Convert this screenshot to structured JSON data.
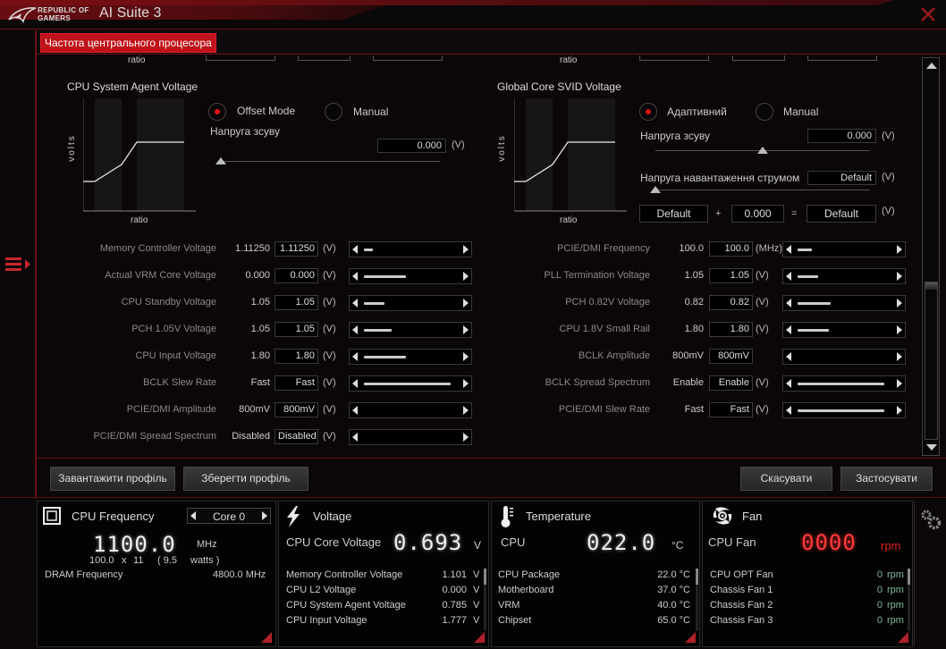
{
  "window": {
    "brand_line1": "REPUBLIC OF",
    "brand_line2": "GAMERS",
    "title": "AI Suite 3"
  },
  "tab": {
    "active_label": "Частота центрального процесора"
  },
  "top_partial": {
    "ratio_left": "ratio",
    "ratio_right": "ratio"
  },
  "sa_voltage": {
    "title": "CPU System Agent Voltage",
    "graph_y": "volts",
    "graph_x": "ratio",
    "mode_options": [
      {
        "label": "Offset Mode",
        "selected": true
      },
      {
        "label": "Manual",
        "selected": false
      }
    ],
    "offset_label": "Напруга зсуву",
    "offset_value": "0.000",
    "unit": "(V)",
    "slider_fraction": 0.0
  },
  "svid_voltage": {
    "title": "Global Core SVID Voltage",
    "graph_y": "volts",
    "graph_x": "ratio",
    "mode_options": [
      {
        "label": "Адаптивний",
        "selected": true
      },
      {
        "label": "Manual",
        "selected": false
      }
    ],
    "offset_label": "Напруга зсуву",
    "offset_value": "0.000",
    "offset_slider_fraction": 0.5,
    "load_label": "Напруга навантаження струмом",
    "load_value": "Default",
    "load_slider_fraction": 0.0,
    "unit": "(V)",
    "sum": {
      "a": "Default",
      "plus": "+",
      "b": "0.000",
      "eq": "=",
      "result": "Default",
      "unit": "(V)"
    }
  },
  "left_rows": [
    {
      "label": "Memory Controller Voltage",
      "current": "1.11250",
      "value": "1.11250",
      "unit": "(V)",
      "fill": 0.1
    },
    {
      "label": "Actual VRM Core Voltage",
      "current": "0.000",
      "value": "0.000",
      "unit": "(V)",
      "fill": 0.45
    },
    {
      "label": "CPU Standby Voltage",
      "current": "1.05",
      "value": "1.05",
      "unit": "(V)",
      "fill": 0.22
    },
    {
      "label": "PCH 1.05V Voltage",
      "current": "1.05",
      "value": "1.05",
      "unit": "(V)",
      "fill": 0.3
    },
    {
      "label": "CPU Input Voltage",
      "current": "1.80",
      "value": "1.80",
      "unit": "(V)",
      "fill": 0.45
    },
    {
      "label": "BCLK Slew Rate",
      "current": "Fast",
      "value": "Fast",
      "unit": "(V)",
      "fill": 0.93
    },
    {
      "label": "PCIE/DMI Amplitude",
      "current": "800mV",
      "value": "800mV",
      "unit": "(V)",
      "fill": 0
    },
    {
      "label": "PCIE/DMI Spread Spectrum",
      "current": "Disabled",
      "value": "Disabled",
      "unit": "(V)",
      "fill": 0
    }
  ],
  "right_rows": [
    {
      "label": "PCIE/DMI Frequency",
      "current": "100.0",
      "value": "100.0",
      "unit": "(MHz)",
      "fill": 0.15
    },
    {
      "label": "PLL Termination Voltage",
      "current": "1.05",
      "value": "1.05",
      "unit": "(V)",
      "fill": 0.22
    },
    {
      "label": "PCH 0.82V Voltage",
      "current": "0.82",
      "value": "0.82",
      "unit": "(V)",
      "fill": 0.36
    },
    {
      "label": "CPU 1.8V Small Rail",
      "current": "1.80",
      "value": "1.80",
      "unit": "(V)",
      "fill": 0.34
    },
    {
      "label": "BCLK Amplitude",
      "current": "800mV",
      "value": "800mV",
      "unit": "",
      "fill": 0
    },
    {
      "label": "BCLK Spread Spectrum",
      "current": "Enable",
      "value": "Enable",
      "unit": "(V)",
      "fill": 0.93
    },
    {
      "label": "PCIE/DMI Slew Rate",
      "current": "Fast",
      "value": "Fast",
      "unit": "(V)",
      "fill": 0.93
    }
  ],
  "buttons": {
    "load_profile": "Завантажити профіль",
    "save_profile": "Зберегти профіль",
    "cancel": "Скасувати",
    "apply": "Застосувати"
  },
  "monitor": {
    "cpu_freq": {
      "title": "CPU Frequency",
      "core_select": "Core 0",
      "value": "1100.0",
      "unit": "MHz",
      "bclk": "100.0",
      "x": "x",
      "ratio": "11",
      "watts_open": "( 9.5",
      "watts_label": "watts )",
      "dram_label": "DRAM Frequency",
      "dram_value": "4800.0  MHz"
    },
    "voltage": {
      "title": "Voltage",
      "main_label": "CPU Core Voltage",
      "main_value": "0.693",
      "main_unit": "V",
      "items": [
        {
          "label": "Memory Controller Voltage",
          "value": "1.101",
          "unit": "V"
        },
        {
          "label": "CPU L2 Voltage",
          "value": "0.000",
          "unit": "V"
        },
        {
          "label": "CPU System Agent Voltage",
          "value": "0.785",
          "unit": "V"
        },
        {
          "label": "CPU Input Voltage",
          "value": "1.777",
          "unit": "V"
        }
      ]
    },
    "temperature": {
      "title": "Temperature",
      "main_label": "CPU",
      "main_value": "022.0",
      "main_unit": "°C",
      "items": [
        {
          "label": "CPU Package",
          "value": "22.0 °C"
        },
        {
          "label": "Motherboard",
          "value": "37.0 °C"
        },
        {
          "label": "VRM",
          "value": "40.0 °C"
        },
        {
          "label": "Chipset",
          "value": "65.0 °C"
        }
      ]
    },
    "fan": {
      "title": "Fan",
      "main_label": "CPU Fan",
      "main_value": "0000",
      "main_unit": "rpm",
      "items": [
        {
          "label": "CPU OPT Fan",
          "value": "0",
          "unit": "rpm"
        },
        {
          "label": "Chassis Fan 1",
          "value": "0",
          "unit": "rpm"
        },
        {
          "label": "Chassis Fan 2",
          "value": "0",
          "unit": "rpm"
        },
        {
          "label": "Chassis Fan 3",
          "value": "0",
          "unit": "rpm"
        }
      ]
    }
  },
  "colors": {
    "accent": "#c0121a",
    "fan_alert": "#ff2a2a",
    "fan_value": "#7fb89a"
  }
}
